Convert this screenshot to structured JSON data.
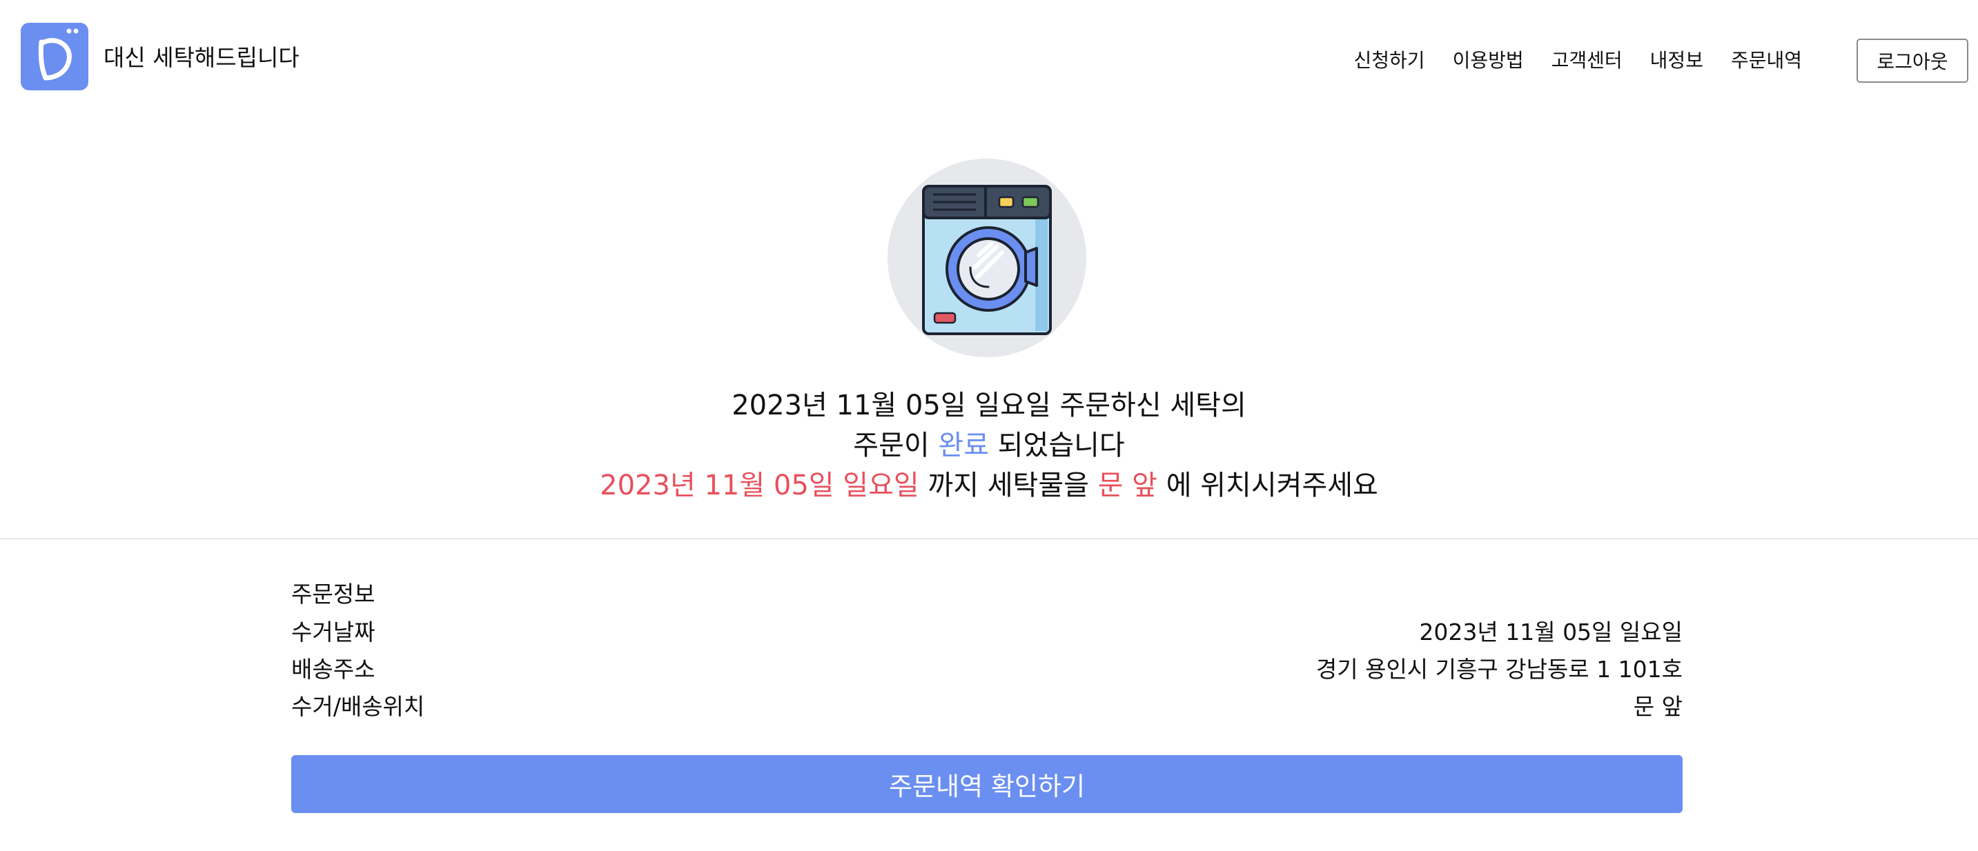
{
  "header": {
    "brand": "대신 세탁해드립니다",
    "nav": [
      "신청하기",
      "이용방법",
      "고객센터",
      "내정보",
      "주문내역"
    ],
    "logout_label": "로그아웃",
    "logo_icon": "laundry-d-logo-icon"
  },
  "hero": {
    "icon": "washing-machine-icon",
    "line1": "2023년 11월 05일 일요일 주문하신 세탁의",
    "line2_before": "주문이 ",
    "line2_status": "완료",
    "line2_after": " 되었습니다",
    "line3_date": "2023년 11월 05일 일요일",
    "line3_mid": " 까지 세탁물을 ",
    "line3_place": "문 앞",
    "line3_end": " 에 위치시켜주세요"
  },
  "order_info": {
    "title": "주문정보",
    "rows": [
      {
        "label": "수거날짜",
        "value": "2023년 11월 05일 일요일"
      },
      {
        "label": "배송주소",
        "value": "경기 용인시 기흥구 강남동로 1 101호"
      },
      {
        "label": "수거/배송위치",
        "value": "문 앞"
      }
    ]
  },
  "cta_label": "주문내역 확인하기",
  "colors": {
    "accent": "#6b8ff0",
    "highlight": "#e8505b",
    "icon_bg": "#e7e8ec"
  }
}
